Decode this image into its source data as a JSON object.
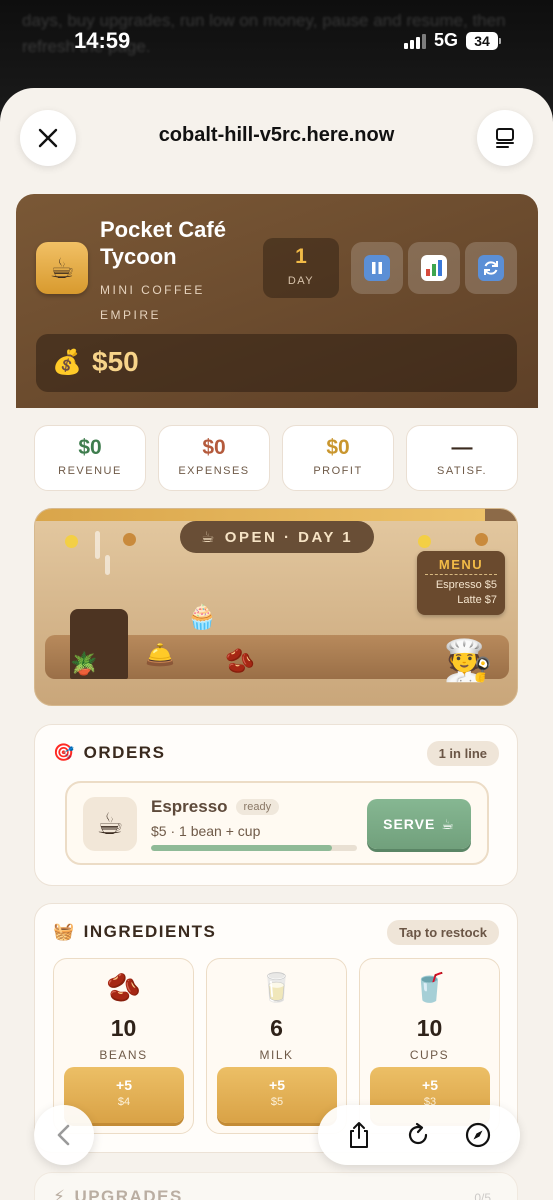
{
  "backdrop_text": "days, buy upgrades, run low on money, pause and resume, then refresh the page.",
  "status": {
    "time": "14:59",
    "network": "5G",
    "battery": "34"
  },
  "browser": {
    "url": "cobalt-hill-v5rc.here.now"
  },
  "header": {
    "logo_emoji": "☕",
    "title": "Pocket Café Tycoon",
    "subtitle": "MINI COFFEE EMPIRE",
    "day_value": "1",
    "day_label": "DAY",
    "money_icon": "💰",
    "money": "$50"
  },
  "stats": [
    {
      "value": "$0",
      "label": "REVENUE",
      "color": "#3f7d4e"
    },
    {
      "value": "$0",
      "label": "EXPENSES",
      "color": "#b45a3c"
    },
    {
      "value": "$0",
      "label": "PROFIT",
      "color": "#c9962e"
    },
    {
      "value": "—",
      "label": "SATISF.",
      "color": "#3a2a1e"
    }
  ],
  "scene": {
    "status_emoji": "☕",
    "status": "OPEN · DAY 1",
    "menu_title": "MENU",
    "menu_items": [
      "Espresso $5",
      "Latte $7"
    ],
    "cupcake": "🧁",
    "bell": "🛎️",
    "beans": "🫘",
    "plant": "🪴",
    "chef": "🧑‍🍳"
  },
  "orders": {
    "icon": "🎯",
    "title": "ORDERS",
    "queue": "1 in line",
    "item": {
      "emoji": "☕",
      "name": "Espresso",
      "state": "ready",
      "detail": "$5 · 1 bean + cup",
      "progress": 0.88,
      "serve_label": "SERVE",
      "serve_emoji": "☕"
    }
  },
  "ingredients": {
    "icon": "🧺",
    "title": "INGREDIENTS",
    "hint": "Tap to restock",
    "items": [
      {
        "emoji": "🫘",
        "qty": "10",
        "name": "BEANS",
        "add": "+5",
        "price": "$4"
      },
      {
        "emoji": "🥛",
        "qty": "6",
        "name": "MILK",
        "add": "+5",
        "price": "$5"
      },
      {
        "emoji": "🥤",
        "qty": "10",
        "name": "CUPS",
        "add": "+5",
        "price": "$3"
      }
    ]
  },
  "upgrades": {
    "icon": "⚡",
    "title": "UPGRADES",
    "count": "0/5"
  },
  "colors": {
    "accent": "#f2bb47",
    "header_bg": "#6b4a2e",
    "serve_green": "#7aa885",
    "restock_gold": "#e1ad52"
  }
}
